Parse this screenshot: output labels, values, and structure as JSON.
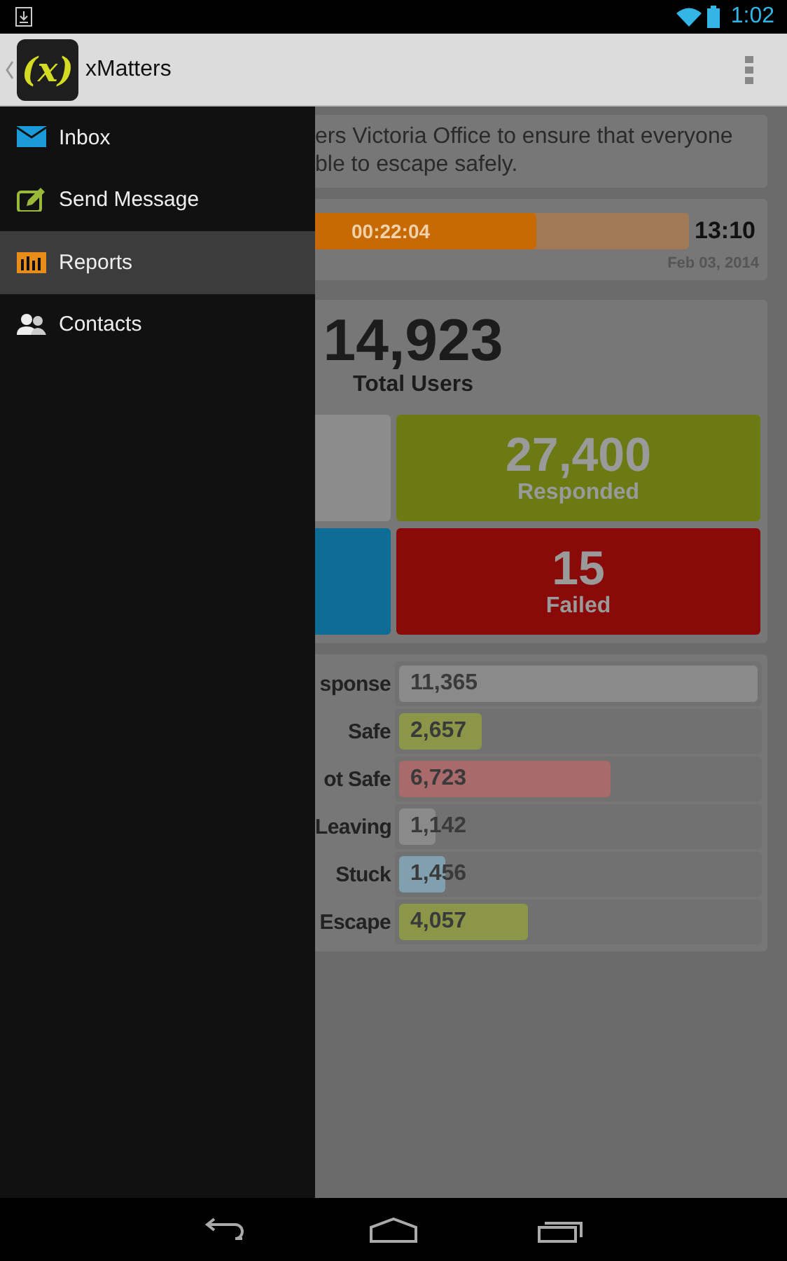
{
  "status_bar": {
    "time": "1:02"
  },
  "app_bar": {
    "logo_text": "(x)",
    "title": "xMatters"
  },
  "drawer": {
    "items": [
      {
        "label": "Inbox",
        "kind": "inbox",
        "selected": false
      },
      {
        "label": "Send Message",
        "kind": "compose",
        "selected": false
      },
      {
        "label": "Reports",
        "kind": "reports",
        "selected": true
      },
      {
        "label": "Contacts",
        "kind": "contacts",
        "selected": false
      }
    ]
  },
  "message": {
    "lines": [
      "ers Victoria Office to ensure that everyone",
      "ble to escape safely."
    ]
  },
  "timer": {
    "elapsed": "00:22:04",
    "level": 0.59,
    "end_time": "13:10",
    "date": "Feb 03, 2014"
  },
  "summary": {
    "total": "14,923",
    "total_label": "Total Users",
    "tiles": [
      {
        "color": "#8c8c8c"
      },
      {
        "value": "27,400",
        "label": "Responded",
        "color": "#6b7a12"
      },
      {
        "color": "#0c6c95"
      },
      {
        "value": "15",
        "label": "Failed",
        "color": "#8a0a0a"
      }
    ]
  },
  "bars": [
    {
      "label": "sponse",
      "value": "11,365",
      "level": 1.0,
      "color": "#8a8a8a"
    },
    {
      "label": "Safe",
      "value": "2,657",
      "level": 0.23,
      "color": "#8c9648"
    },
    {
      "label": "ot Safe",
      "value": "6,723",
      "level": 0.59,
      "color": "#a86a6a"
    },
    {
      "label": "Leaving",
      "value": "1,142",
      "level": 0.1,
      "color": "#8a8a8a"
    },
    {
      "label": "Stuck",
      "value": "1,456",
      "level": 0.13,
      "color": "#80a0b0"
    },
    {
      "label": "Escape",
      "value": "4,057",
      "level": 0.36,
      "color": "#8c9648"
    }
  ]
}
